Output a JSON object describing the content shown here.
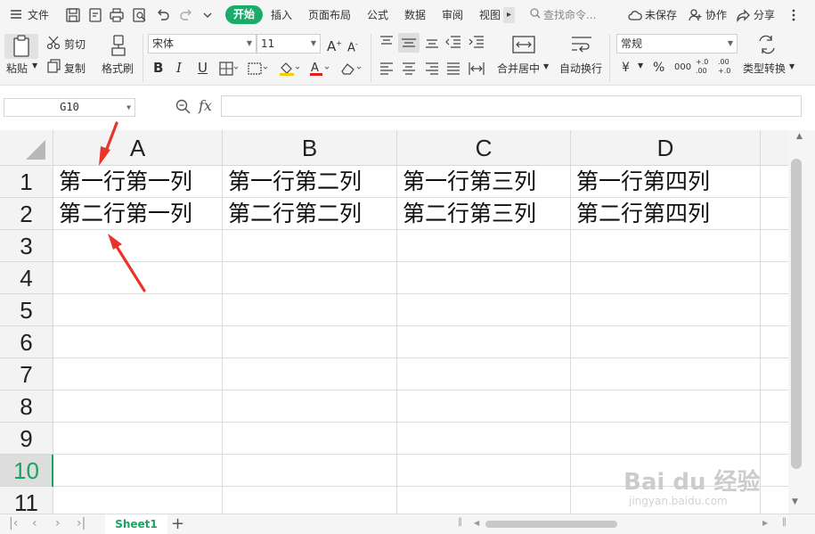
{
  "menu": {
    "file": "文件",
    "tabs": [
      "开始",
      "插入",
      "页面布局",
      "公式",
      "数据",
      "审阅",
      "视图"
    ],
    "search": "查找命令...",
    "unsaved": "未保存",
    "collab": "协作",
    "share": "分享"
  },
  "ribbon": {
    "paste": "粘贴",
    "cut": "剪切",
    "copy": "复制",
    "format_painter": "格式刷",
    "font_name": "宋体",
    "font_size": "11",
    "merge_center": "合并居中",
    "wrap_text": "自动换行",
    "number_format": "常规",
    "type_convert": "类型转换",
    "currency_symbol": "¥",
    "percent_symbol": "%",
    "thousands_symbol": "000",
    "dec_increase": "+.0 .00",
    "dec_decrease": ".00 +.0"
  },
  "formula_bar": {
    "name_box": "G10",
    "fx": "fx",
    "content": ""
  },
  "sheet": {
    "columns": [
      "A",
      "B",
      "C",
      "D"
    ],
    "rows": [
      "1",
      "2",
      "3",
      "4",
      "5",
      "6",
      "7",
      "8",
      "9",
      "10",
      "11"
    ],
    "active_row": "10",
    "cells": [
      [
        "第一行第一列",
        "第一行第二列",
        "第一行第三列",
        "第一行第四列"
      ],
      [
        "第二行第一列",
        "第二行第二列",
        "第二行第三列",
        "第二行第四列"
      ]
    ]
  },
  "sheet_tabs": [
    "Sheet1"
  ],
  "watermark": {
    "main": "Bai du 经验",
    "sub": "jingyan.baidu.com"
  },
  "colors": {
    "accent_green": "#1aad6a",
    "arrow_red": "#e8342a"
  }
}
